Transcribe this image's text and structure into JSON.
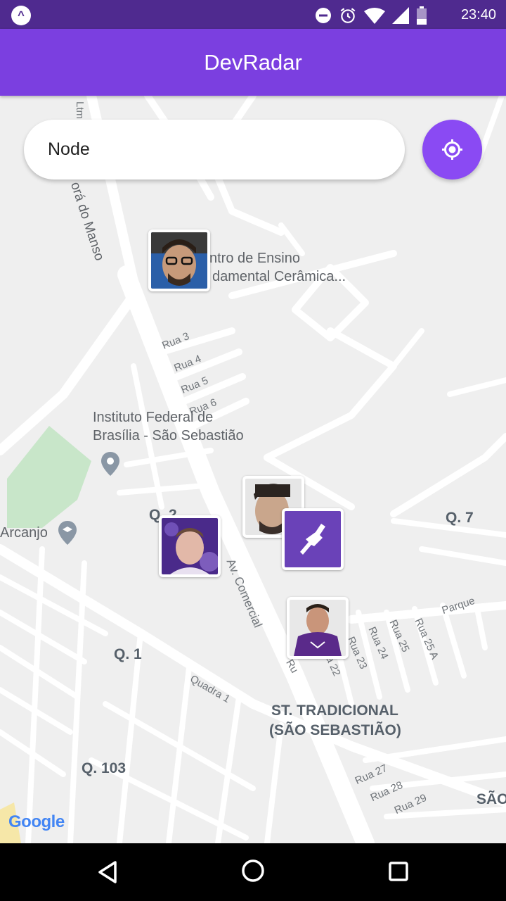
{
  "status_bar": {
    "time": "23:40",
    "app_badge": "^",
    "icons": [
      "do-not-disturb-icon",
      "alarm-icon",
      "wifi-icon",
      "signal-icon",
      "battery-icon"
    ]
  },
  "app_bar": {
    "title": "DevRadar"
  },
  "search": {
    "value": "Node",
    "placeholder": ""
  },
  "map": {
    "labels": {
      "street_ltm": "Ltm",
      "street_manso": "orá do Manso",
      "school_1": "ntro de Ensino",
      "school_2": "damental Cerâmica...",
      "rua3": "Rua 3",
      "rua4": "Rua 4",
      "rua5": "Rua 5",
      "rua6": "Rua 6",
      "ifb_1": "Instituto Federal de",
      "ifb_2": "Brasília - São Sebastião",
      "q2": "Q. 2",
      "arcanjo": "Arcanjo",
      "q7": "Q. 7",
      "av_comercial": "Av. Comercial",
      "q1": "Q. 1",
      "quadra1": "Quadra 1",
      "parque": "Parque",
      "rua22": "Rua 22",
      "rua23": "Rua 23",
      "rua24": "Rua 24",
      "rua25": "Rua 25",
      "rua25a": "Rua 25 A",
      "rua_partial": "Ru",
      "st_trad_1": "ST. TRADICIONAL",
      "st_trad_2": "(SÃO SEBASTIÃO)",
      "q103": "Q. 103",
      "rua27": "Rua 27",
      "rua28": "Rua 28",
      "rua29": "Rua 29",
      "sao": "SÃO"
    },
    "google_logo": "Google"
  },
  "colors": {
    "status_bar": "#4f2a8f",
    "app_bar": "#7b3fe0",
    "accent": "#8a4af3",
    "map_bg": "#efefef",
    "road": "#ffffff",
    "park": "#c8e6c9"
  }
}
